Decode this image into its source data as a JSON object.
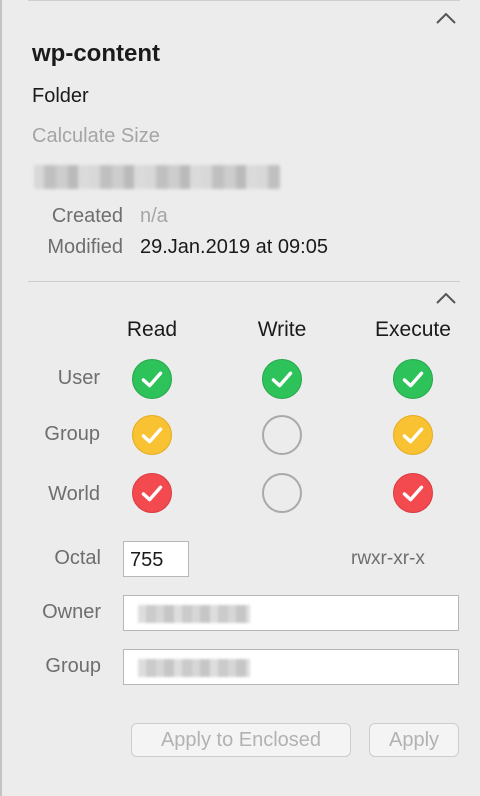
{
  "item": {
    "name": "wp-content",
    "kind": "Folder",
    "calculate_size_label": "Calculate Size"
  },
  "dates": {
    "created_label": "Created",
    "created_value": "n/a",
    "modified_label": "Modified",
    "modified_value": "29.Jan.2019 at 09:05"
  },
  "permissions": {
    "columns": [
      "Read",
      "Write",
      "Execute"
    ],
    "rows": [
      {
        "label": "User",
        "states": [
          "granted",
          "granted",
          "granted"
        ]
      },
      {
        "label": "Group",
        "states": [
          "partial",
          "unset",
          "partial"
        ]
      },
      {
        "label": "World",
        "states": [
          "denied",
          "unset",
          "denied"
        ]
      }
    ],
    "state_colors": {
      "granted": "#2ec25a",
      "partial": "#f9c232",
      "denied": "#f34a4f"
    }
  },
  "octal": {
    "label": "Octal",
    "value": "755",
    "symbolic": "rwxr-xr-x"
  },
  "owner": {
    "label": "Owner"
  },
  "group": {
    "label": "Group"
  },
  "buttons": {
    "apply_enclosed": "Apply to Enclosed",
    "apply": "Apply"
  },
  "icons": {
    "collapse": "chevron-up-icon",
    "check": "checkmark-icon"
  }
}
